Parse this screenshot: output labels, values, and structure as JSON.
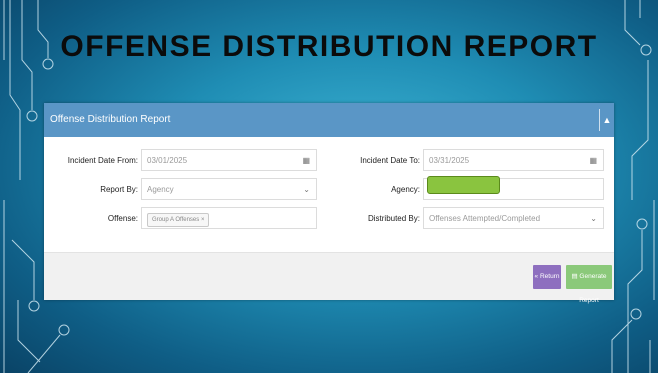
{
  "slide": {
    "title": "OFFENSE DISTRIBUTION REPORT"
  },
  "panel": {
    "title": "Offense Distribution Report",
    "collapse_icon": "chevron-up-icon"
  },
  "form": {
    "incident_date_from": {
      "label": "Incident Date From:",
      "value": "03/01/2025",
      "icon": "calendar-icon"
    },
    "incident_date_to": {
      "label": "Incident Date To:",
      "value": "03/31/2025",
      "icon": "calendar-icon"
    },
    "report_by": {
      "label": "Report By:",
      "value": "Agency",
      "icon": "chevron-down-icon"
    },
    "agency": {
      "label": "Agency:",
      "value": "",
      "highlight_color": "#8ac43f"
    },
    "offense": {
      "label": "Offense:",
      "tag": "Group A Offenses",
      "tag_remove": "×"
    },
    "distributed_by": {
      "label": "Distributed By:",
      "value": "Offenses Attempted/Completed",
      "icon": "chevron-down-icon"
    }
  },
  "buttons": {
    "return_label": "Return",
    "return_icon": "«",
    "generate_label": "Generate Report",
    "generate_icon": "document-icon"
  },
  "colors": {
    "header_blue": "#5a96c6",
    "return_purple": "#8e6fbf",
    "generate_green": "#8bc97a"
  }
}
